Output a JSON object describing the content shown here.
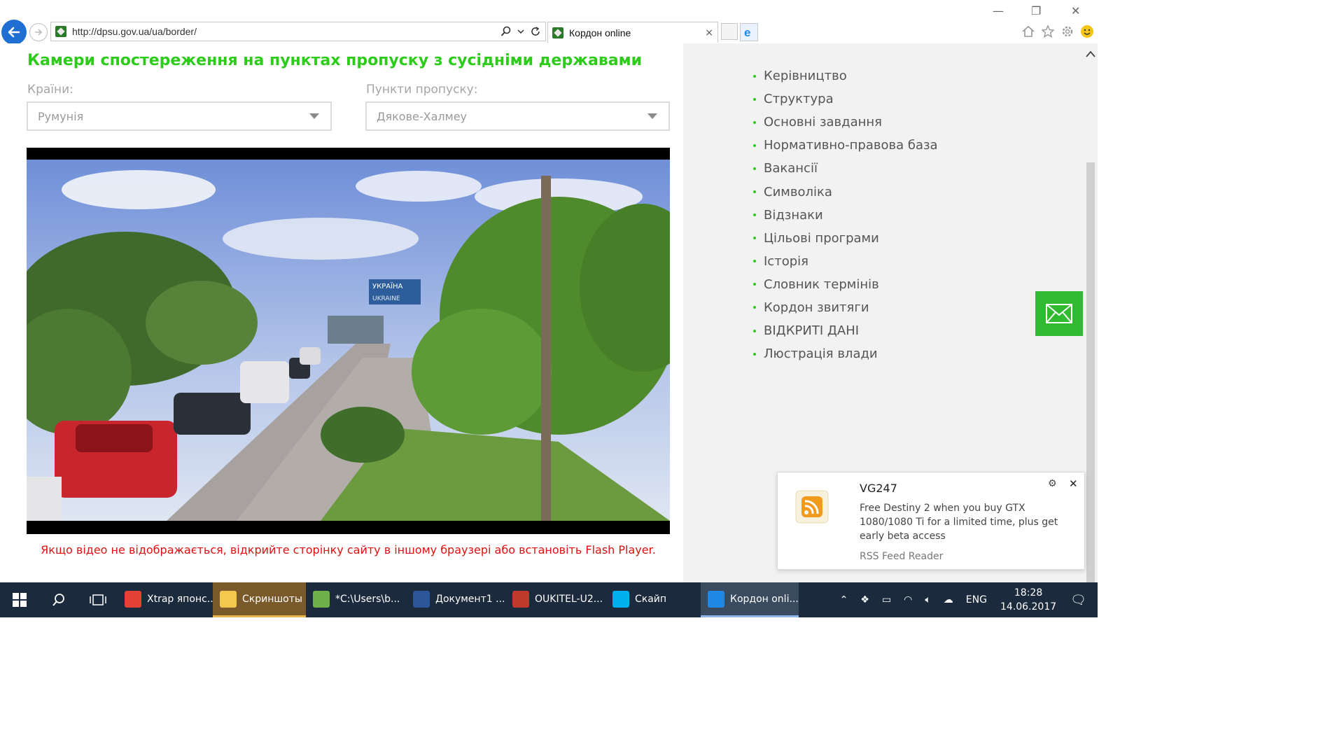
{
  "browser": {
    "url": "http://dpsu.gov.ua/ua/border/",
    "tab_title": "Кордон online",
    "tab_close": "×"
  },
  "page": {
    "title": "Камери спостереження на пунктах пропуску з сусідніми державами",
    "countries_label": "Країни:",
    "countries_value": "Румунія",
    "checkpoints_label": "Пункти пропуску:",
    "checkpoints_value": "Дякове-Халмеу",
    "video_sign_line1": "УКРАЇНА",
    "video_sign_line2": "UKRAINE",
    "notice": "Якщо відео не відображається, відкрийте сторінку сайту в іншому браузері або встановіть Flash Player."
  },
  "side_menu": [
    "Керівництво",
    "Структура",
    "Основні завдання",
    "Нормативно-правова база",
    "Вакансії",
    "Символіка",
    "Відзнаки",
    "Цільові програми",
    "Історія",
    "Словник термінів",
    "Кордон звитяги",
    "ВІДКРИТІ ДАНІ",
    "Люстрація влади"
  ],
  "toast": {
    "app": "VG247",
    "body": "Free Destiny 2 when you buy GTX 1080/1080 Ti for a limited time, plus get early beta access",
    "source": "RSS Feed Reader"
  },
  "taskbar": {
    "apps": [
      {
        "label": "Xtrap японс...",
        "icon": "chrome-icon",
        "color": "#e44134",
        "state": ""
      },
      {
        "label": "Скриншоты",
        "icon": "folder-icon",
        "color": "#f2c94c",
        "state": "hot"
      },
      {
        "label": "*C:\\Users\\b...",
        "icon": "notepad-icon",
        "color": "#6fb04a",
        "state": ""
      },
      {
        "label": "Документ1 ...",
        "icon": "word-icon",
        "color": "#2b579a",
        "state": ""
      },
      {
        "label": "OUKITEL-U2...",
        "icon": "eye-icon",
        "color": "#c0392b",
        "state": ""
      },
      {
        "label": "Скайп",
        "icon": "skype-icon",
        "color": "#00aff0",
        "state": ""
      },
      {
        "label": "Кордон onli...",
        "icon": "ie-icon",
        "color": "#1e88e5",
        "state": "active"
      }
    ],
    "lang": "ENG",
    "time": "18:28",
    "date": "14.06.2017"
  },
  "colors": {
    "accent_green": "#2ecc1a",
    "notice_red": "#e01010",
    "taskbar_bg": "#1b2a3c"
  }
}
